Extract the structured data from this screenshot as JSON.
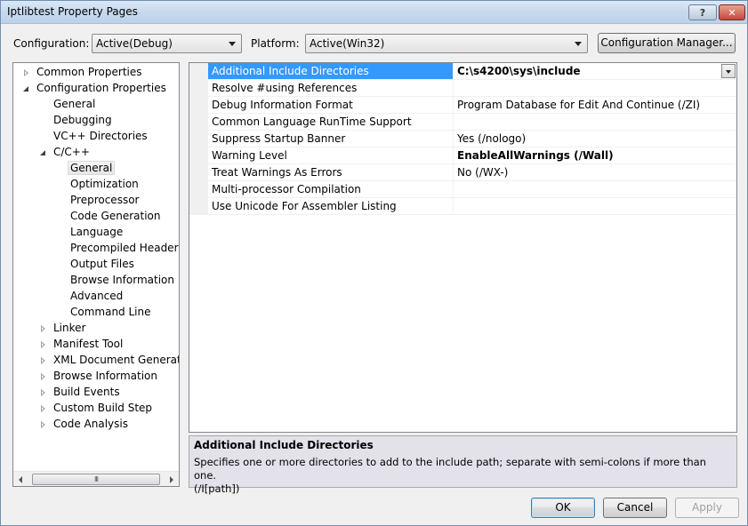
{
  "window": {
    "title": "Iptlibtest Property Pages",
    "help_label": "?",
    "close_label": "✕"
  },
  "toolbar": {
    "configuration_label": "Configuration:",
    "configuration_value": "Active(Debug)",
    "platform_label": "Platform:",
    "platform_value": "Active(Win32)",
    "config_manager_label": "Configuration Manager..."
  },
  "tree": {
    "items": [
      {
        "label": "Common Properties",
        "level": 0,
        "state": "collapsed"
      },
      {
        "label": "Configuration Properties",
        "level": 0,
        "state": "expanded"
      },
      {
        "label": "General",
        "level": 1,
        "state": "none"
      },
      {
        "label": "Debugging",
        "level": 1,
        "state": "none"
      },
      {
        "label": "VC++ Directories",
        "level": 1,
        "state": "none"
      },
      {
        "label": "C/C++",
        "level": 1,
        "state": "expanded"
      },
      {
        "label": "General",
        "level": 2,
        "state": "none",
        "selected": true
      },
      {
        "label": "Optimization",
        "level": 2,
        "state": "none"
      },
      {
        "label": "Preprocessor",
        "level": 2,
        "state": "none"
      },
      {
        "label": "Code Generation",
        "level": 2,
        "state": "none"
      },
      {
        "label": "Language",
        "level": 2,
        "state": "none"
      },
      {
        "label": "Precompiled Headers",
        "level": 2,
        "state": "none"
      },
      {
        "label": "Output Files",
        "level": 2,
        "state": "none"
      },
      {
        "label": "Browse Information",
        "level": 2,
        "state": "none"
      },
      {
        "label": "Advanced",
        "level": 2,
        "state": "none"
      },
      {
        "label": "Command Line",
        "level": 2,
        "state": "none"
      },
      {
        "label": "Linker",
        "level": 1,
        "state": "collapsed"
      },
      {
        "label": "Manifest Tool",
        "level": 1,
        "state": "collapsed"
      },
      {
        "label": "XML Document Generator",
        "level": 1,
        "state": "collapsed"
      },
      {
        "label": "Browse Information",
        "level": 1,
        "state": "collapsed"
      },
      {
        "label": "Build Events",
        "level": 1,
        "state": "collapsed"
      },
      {
        "label": "Custom Build Step",
        "level": 1,
        "state": "collapsed"
      },
      {
        "label": "Code Analysis",
        "level": 1,
        "state": "collapsed"
      }
    ],
    "scroll_thumb_label": "III"
  },
  "grid": {
    "rows": [
      {
        "name": "Additional Include Directories",
        "value": "C:\\s4200\\sys\\include",
        "bold": true,
        "selected": true
      },
      {
        "name": "Resolve #using References",
        "value": "",
        "bold": false
      },
      {
        "name": "Debug Information Format",
        "value": "Program Database for Edit And Continue (/ZI)",
        "bold": false
      },
      {
        "name": "Common Language RunTime Support",
        "value": "",
        "bold": false
      },
      {
        "name": "Suppress Startup Banner",
        "value": "Yes (/nologo)",
        "bold": false
      },
      {
        "name": "Warning Level",
        "value": "EnableAllWarnings (/Wall)",
        "bold": true
      },
      {
        "name": "Treat Warnings As Errors",
        "value": "No (/WX-)",
        "bold": false
      },
      {
        "name": "Multi-processor Compilation",
        "value": "",
        "bold": false
      },
      {
        "name": "Use Unicode For Assembler Listing",
        "value": "",
        "bold": false
      }
    ]
  },
  "description": {
    "title": "Additional Include Directories",
    "body": "Specifies one or more directories to add to the include path; separate with semi-colons if more than one.",
    "switch": "(/I[path])"
  },
  "buttons": {
    "ok": "OK",
    "cancel": "Cancel",
    "apply": "Apply"
  }
}
